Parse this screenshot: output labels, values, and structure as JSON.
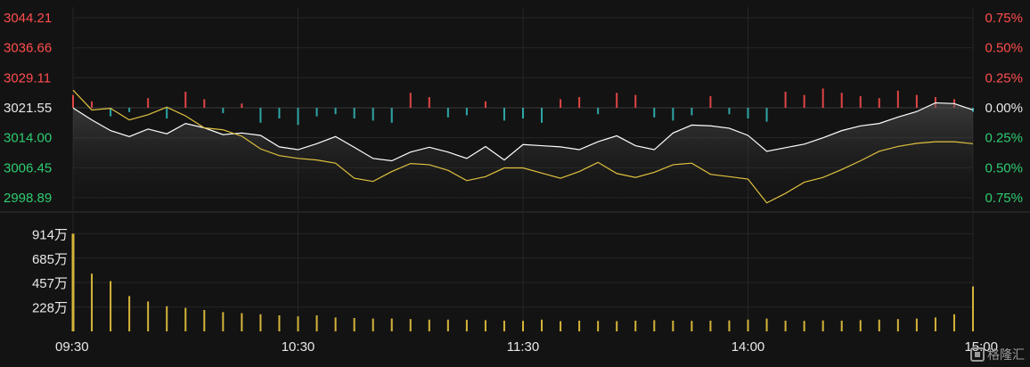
{
  "chart_data": {
    "type": "line",
    "price_axis": {
      "ticks": [
        "3044.21",
        "3036.66",
        "3029.11",
        "3021.55",
        "3014.00",
        "3006.45",
        "2998.89"
      ],
      "values": [
        3044.21,
        3036.66,
        3029.11,
        3021.55,
        3014.0,
        3006.45,
        2998.89
      ],
      "reference": 3021.55
    },
    "percent_axis": {
      "ticks": [
        "0.75%",
        "0.50%",
        "0.25%",
        "0.00%",
        "0.25%",
        "0.50%",
        "0.75%"
      ]
    },
    "volume_axis": {
      "ticks": [
        "914万",
        "685万",
        "457万",
        "228万"
      ],
      "values": [
        914,
        685,
        457,
        228
      ],
      "unit": "万"
    },
    "time_axis": {
      "ticks": [
        "09:30",
        "10:30",
        "11:30",
        "14:00",
        "15:00"
      ]
    },
    "x": [
      "09:30",
      "09:35",
      "09:40",
      "09:45",
      "09:50",
      "09:55",
      "10:00",
      "10:05",
      "10:10",
      "10:15",
      "10:20",
      "10:25",
      "10:30",
      "10:35",
      "10:40",
      "10:45",
      "10:50",
      "10:55",
      "11:00",
      "11:05",
      "11:10",
      "11:15",
      "11:20",
      "11:25",
      "11:30",
      "13:05",
      "13:10",
      "13:15",
      "13:20",
      "13:25",
      "13:30",
      "13:35",
      "13:40",
      "13:45",
      "13:50",
      "13:55",
      "14:00",
      "14:05",
      "14:10",
      "14:15",
      "14:20",
      "14:25",
      "14:30",
      "14:35",
      "14:40",
      "14:45",
      "14:50",
      "14:55",
      "15:00"
    ],
    "series": [
      {
        "color": "#ffffff",
        "values": [
          3021.5,
          3018.5,
          3015.8,
          3014.3,
          3016.2,
          3015.0,
          3017.6,
          3016.5,
          3014.8,
          3015.2,
          3014.6,
          3011.7,
          3011.0,
          3012.5,
          3014.3,
          3011.6,
          3008.8,
          3008.2,
          3010.4,
          3011.6,
          3010.4,
          3008.8,
          3011.8,
          3008.4,
          3012.3,
          3012.0,
          3011.7,
          3011.0,
          3013.0,
          3014.5,
          3012.0,
          3011.0,
          3015.2,
          3017.2,
          3017.0,
          3016.4,
          3014.6,
          3010.6,
          3011.5,
          3012.4,
          3014.0,
          3015.8,
          3017.0,
          3017.6,
          3019.2,
          3020.6,
          3022.8,
          3022.6,
          3021.0
        ]
      },
      {
        "color": "#e0c140",
        "values": [
          3026.0,
          3021.0,
          3021.4,
          3018.5,
          3019.8,
          3021.7,
          3019.5,
          3016.5,
          3016.0,
          3014.4,
          3011.2,
          3009.5,
          3008.8,
          3008.4,
          3007.6,
          3003.8,
          3003.0,
          3005.5,
          3007.5,
          3007.2,
          3005.8,
          3003.2,
          3004.2,
          3006.4,
          3006.4,
          3005.1,
          3003.8,
          3005.5,
          3007.8,
          3005.0,
          3004.0,
          3005.3,
          3007.2,
          3007.6,
          3004.8,
          3004.2,
          3003.6,
          2997.6,
          3000.0,
          3002.8,
          3004.0,
          3006.0,
          3008.2,
          3010.6,
          3011.8,
          3012.6,
          3013.0,
          3013.0,
          3012.5
        ]
      }
    ],
    "volume": [
      914,
      540,
      470,
      330,
      280,
      235,
      220,
      200,
      180,
      170,
      160,
      150,
      140,
      150,
      130,
      125,
      120,
      120,
      115,
      110,
      110,
      108,
      105,
      100,
      98,
      110,
      95,
      100,
      98,
      96,
      100,
      105,
      100,
      98,
      100,
      102,
      110,
      120,
      100,
      98,
      102,
      100,
      105,
      110,
      115,
      120,
      130,
      160,
      420
    ],
    "breadth": [
      12,
      6,
      -8,
      -4,
      9,
      -10,
      15,
      8,
      -5,
      4,
      -14,
      -10,
      -16,
      -8,
      -6,
      -10,
      -12,
      -14,
      14,
      10,
      -9,
      -7,
      6,
      -12,
      -10,
      -14,
      8,
      10,
      -6,
      14,
      12,
      -9,
      -12,
      -7,
      11,
      -6,
      -10,
      -13,
      15,
      12,
      18,
      14,
      11,
      9,
      16,
      12,
      10,
      8,
      -4
    ],
    "breadth_colors": {
      "up": "#e04545",
      "down": "#2fa6a6"
    },
    "grid": true
  },
  "watermark": "格隆汇"
}
